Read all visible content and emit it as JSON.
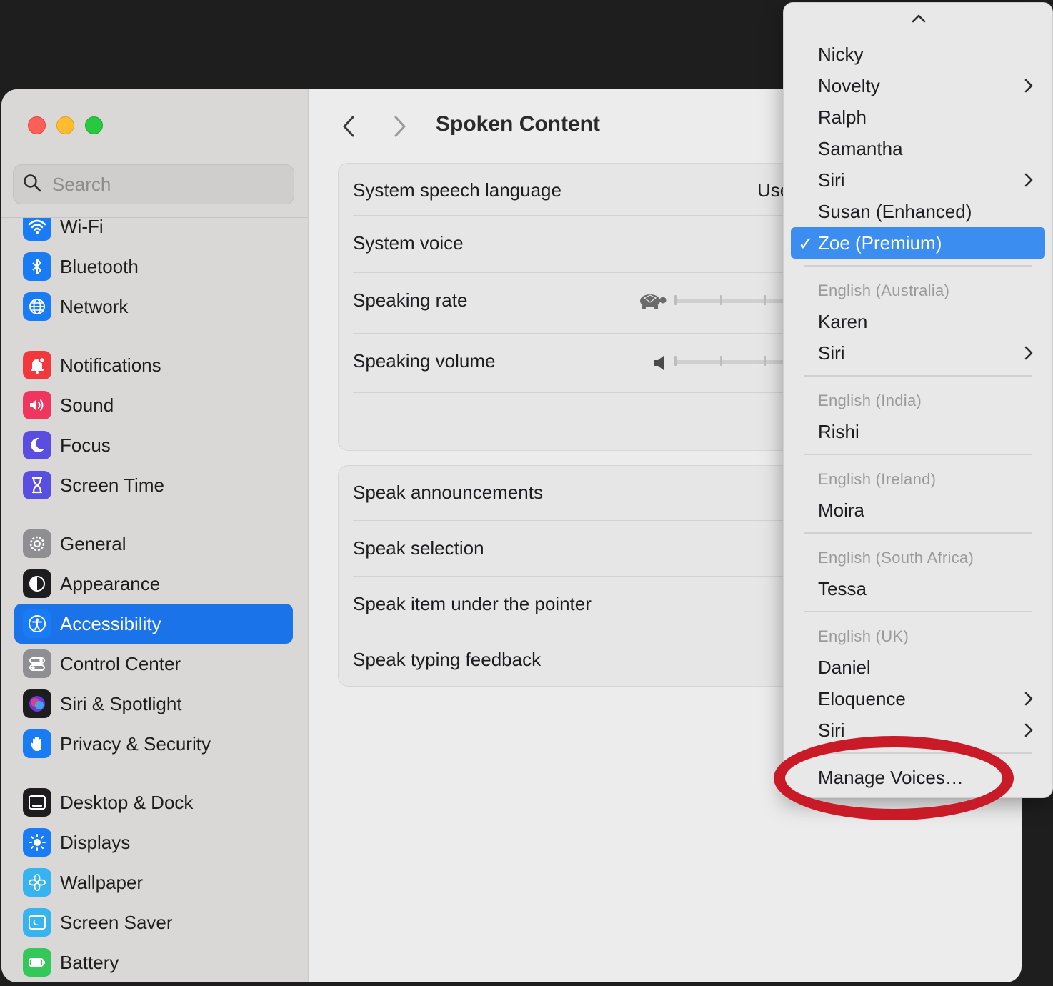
{
  "sidebar": {
    "search_placeholder": "Search",
    "items": [
      {
        "label": "Wi-Fi",
        "icon": "wifi-icon",
        "color": "#1a7cf5"
      },
      {
        "label": "Bluetooth",
        "icon": "bluetooth-icon",
        "color": "#1a7cf5"
      },
      {
        "label": "Network",
        "icon": "globe-icon",
        "color": "#1a7cf5"
      },
      {
        "label": "Notifications",
        "icon": "bell-icon",
        "color": "#f2383c"
      },
      {
        "label": "Sound",
        "icon": "speaker-icon",
        "color": "#f0365f"
      },
      {
        "label": "Focus",
        "icon": "moon-icon",
        "color": "#5a4ee0"
      },
      {
        "label": "Screen Time",
        "icon": "hourglass-icon",
        "color": "#5a4ee0"
      },
      {
        "label": "General",
        "icon": "gear-icon",
        "color": "#8e8e93"
      },
      {
        "label": "Appearance",
        "icon": "appearance-icon",
        "color": "#1d1d1f"
      },
      {
        "label": "Accessibility",
        "icon": "accessibility-icon",
        "color": "#1a7cf5",
        "active": true
      },
      {
        "label": "Control Center",
        "icon": "toggles-icon",
        "color": "#8e8e93"
      },
      {
        "label": "Siri & Spotlight",
        "icon": "siri-icon",
        "color": "#6a3ad6"
      },
      {
        "label": "Privacy & Security",
        "icon": "hand-icon",
        "color": "#1a7cf5"
      },
      {
        "label": "Desktop & Dock",
        "icon": "dock-icon",
        "color": "#1d1d1f"
      },
      {
        "label": "Displays",
        "icon": "sun-icon",
        "color": "#1a7cf5"
      },
      {
        "label": "Wallpaper",
        "icon": "flower-icon",
        "color": "#35b4f0"
      },
      {
        "label": "Screen Saver",
        "icon": "screensaver-icon",
        "color": "#35b4f0"
      },
      {
        "label": "Battery",
        "icon": "battery-icon",
        "color": "#34c759"
      }
    ]
  },
  "main": {
    "title": "Spoken Content",
    "panel1": {
      "system_speech_language": "System speech language",
      "system_speech_language_value": "Use",
      "system_voice": "System voice",
      "speaking_rate": "Speaking rate",
      "speaking_volume": "Speaking volume"
    },
    "panel2": {
      "speak_announcements": "Speak announcements",
      "speak_selection": "Speak selection",
      "speak_item_under_pointer": "Speak item under the pointer",
      "speak_typing_feedback": "Speak typing feedback"
    }
  },
  "voice_menu": {
    "items": [
      {
        "label": "Nicky"
      },
      {
        "label": "Novelty",
        "submenu": true
      },
      {
        "label": "Ralph"
      },
      {
        "label": "Samantha"
      },
      {
        "label": "Siri",
        "submenu": true
      },
      {
        "label": "Susan (Enhanced)"
      },
      {
        "label": "Zoe (Premium)",
        "selected": true
      },
      {
        "header": "English (Australia)"
      },
      {
        "label": "Karen"
      },
      {
        "label": "Siri",
        "submenu": true
      },
      {
        "header": "English (India)"
      },
      {
        "label": "Rishi"
      },
      {
        "header": "English (Ireland)"
      },
      {
        "label": "Moira"
      },
      {
        "header": "English (South Africa)"
      },
      {
        "label": "Tessa"
      },
      {
        "header": "English (UK)"
      },
      {
        "label": "Daniel"
      },
      {
        "label": "Eloquence",
        "submenu": true
      },
      {
        "label": "Siri",
        "submenu": true
      },
      {
        "label": "Manage Voices…"
      }
    ],
    "check_mark": "✓"
  },
  "colors": {
    "accent": "#1a73e8",
    "menu_selected": "#3b8ef0",
    "annotation": "#c81a27"
  }
}
